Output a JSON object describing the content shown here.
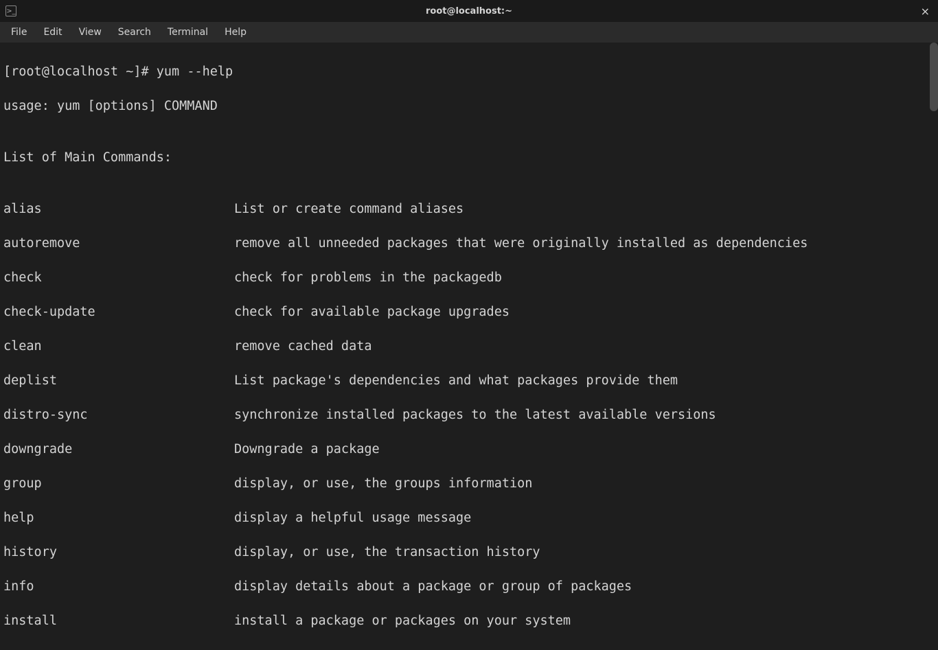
{
  "titlebar": {
    "icon_label": ">_",
    "title": "root@localhost:~",
    "close_label": "×"
  },
  "menubar": {
    "items": [
      "File",
      "Edit",
      "View",
      "Search",
      "Terminal",
      "Help"
    ]
  },
  "terminal": {
    "prompt": "[root@localhost ~]# ",
    "command": "yum --help",
    "usage_line": "usage: yum [options] COMMAND",
    "blank": "",
    "section_header": "List of Main Commands:",
    "commands": [
      {
        "name": "alias",
        "desc": "List or create command aliases"
      },
      {
        "name": "autoremove",
        "desc": "remove all unneeded packages that were originally installed as dependencies"
      },
      {
        "name": "check",
        "desc": "check for problems in the packagedb"
      },
      {
        "name": "check-update",
        "desc": "check for available package upgrades"
      },
      {
        "name": "clean",
        "desc": "remove cached data"
      },
      {
        "name": "deplist",
        "desc": "List package's dependencies and what packages provide them"
      },
      {
        "name": "distro-sync",
        "desc": "synchronize installed packages to the latest available versions"
      },
      {
        "name": "downgrade",
        "desc": "Downgrade a package"
      },
      {
        "name": "group",
        "desc": "display, or use, the groups information"
      },
      {
        "name": "help",
        "desc": "display a helpful usage message"
      },
      {
        "name": "history",
        "desc": "display, or use, the transaction history"
      },
      {
        "name": "info",
        "desc": "display details about a package or group of packages"
      },
      {
        "name": "install",
        "desc": "install a package or packages on your system"
      }
    ]
  }
}
